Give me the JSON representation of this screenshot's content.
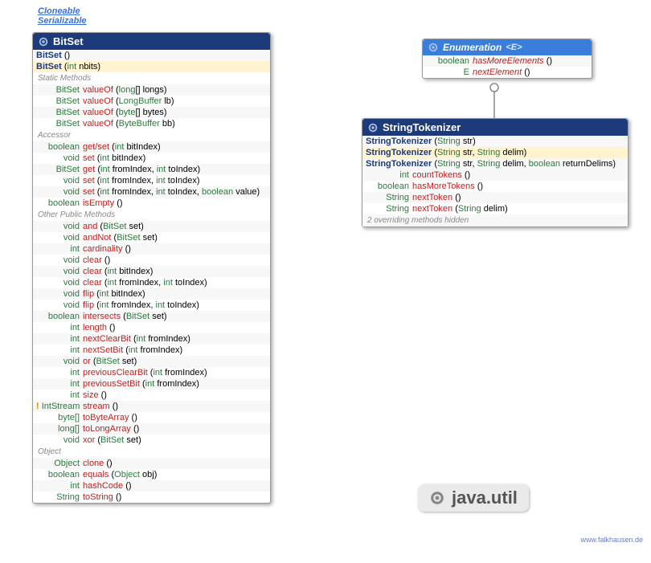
{
  "implements": {
    "cloneable": "Cloneable",
    "serializable": "Serializable"
  },
  "bitset": {
    "title": "BitSet",
    "ctors": [
      {
        "name": "BitSet",
        "params": "()"
      },
      {
        "name": "BitSet",
        "params": "(int nbits)"
      }
    ],
    "sect_static": "Static Methods",
    "static": [
      {
        "ret": "BitSet",
        "name": "valueOf",
        "p": "(long[] longs)"
      },
      {
        "ret": "BitSet",
        "name": "valueOf",
        "p": "(LongBuffer lb)"
      },
      {
        "ret": "BitSet",
        "name": "valueOf",
        "p": "(byte[] bytes)"
      },
      {
        "ret": "BitSet",
        "name": "valueOf",
        "p": "(ByteBuffer bb)"
      }
    ],
    "sect_acc": "Accessor",
    "acc": [
      {
        "ret": "boolean",
        "name": "get/set",
        "p": "(int bitIndex)"
      },
      {
        "ret": "void",
        "name": "set",
        "p": "(int bitIndex)"
      },
      {
        "ret": "BitSet",
        "name": "get",
        "p": "(int fromIndex, int toIndex)"
      },
      {
        "ret": "void",
        "name": "set",
        "p": "(int fromIndex, int toIndex)"
      },
      {
        "ret": "void",
        "name": "set",
        "p": "(int fromIndex, int toIndex, boolean value)"
      },
      {
        "ret": "boolean",
        "name": "isEmpty",
        "p": "()"
      }
    ],
    "sect_other": "Other Public Methods",
    "other": [
      {
        "ret": "void",
        "name": "and",
        "p": "(BitSet set)"
      },
      {
        "ret": "void",
        "name": "andNot",
        "p": "(BitSet set)"
      },
      {
        "ret": "int",
        "name": "cardinality",
        "p": "()"
      },
      {
        "ret": "void",
        "name": "clear",
        "p": "()"
      },
      {
        "ret": "void",
        "name": "clear",
        "p": "(int bitIndex)"
      },
      {
        "ret": "void",
        "name": "clear",
        "p": "(int fromIndex, int toIndex)"
      },
      {
        "ret": "void",
        "name": "flip",
        "p": "(int bitIndex)"
      },
      {
        "ret": "void",
        "name": "flip",
        "p": "(int fromIndex, int toIndex)"
      },
      {
        "ret": "boolean",
        "name": "intersects",
        "p": "(BitSet set)"
      },
      {
        "ret": "int",
        "name": "length",
        "p": "()"
      },
      {
        "ret": "int",
        "name": "nextClearBit",
        "p": "(int fromIndex)"
      },
      {
        "ret": "int",
        "name": "nextSetBit",
        "p": "(int fromIndex)"
      },
      {
        "ret": "void",
        "name": "or",
        "p": "(BitSet set)"
      },
      {
        "ret": "int",
        "name": "previousClearBit",
        "p": "(int fromIndex)"
      },
      {
        "ret": "int",
        "name": "previousSetBit",
        "p": "(int fromIndex)"
      },
      {
        "ret": "int",
        "name": "size",
        "p": "()"
      },
      {
        "ret": "! IntStream",
        "name": "stream",
        "p": "()",
        "excl": true
      },
      {
        "ret": "byte[]",
        "name": "toByteArray",
        "p": "()"
      },
      {
        "ret": "long[]",
        "name": "toLongArray",
        "p": "()"
      },
      {
        "ret": "void",
        "name": "xor",
        "p": "(BitSet set)"
      }
    ],
    "sect_obj": "Object",
    "obj": [
      {
        "ret": "Object",
        "name": "clone",
        "p": "()"
      },
      {
        "ret": "boolean",
        "name": "equals",
        "p": "(Object obj)"
      },
      {
        "ret": "int",
        "name": "hashCode",
        "p": "()"
      },
      {
        "ret": "String",
        "name": "toString",
        "p": "()"
      }
    ]
  },
  "enumeration": {
    "title": "Enumeration",
    "generic": "<E>",
    "methods": [
      {
        "ret": "boolean",
        "name": "hasMoreElements",
        "p": "()"
      },
      {
        "ret": "E",
        "name": "nextElement",
        "p": "()"
      }
    ]
  },
  "stringtokenizer": {
    "title": "StringTokenizer",
    "ctors": [
      {
        "name": "StringTokenizer",
        "p": "(String str)"
      },
      {
        "name": "StringTokenizer",
        "p": "(String str, String delim)"
      },
      {
        "name": "StringTokenizer",
        "p": "(String str, String delim, boolean returnDelims)"
      }
    ],
    "methods": [
      {
        "ret": "int",
        "name": "countTokens",
        "p": "()"
      },
      {
        "ret": "boolean",
        "name": "hasMoreTokens",
        "p": "()"
      },
      {
        "ret": "String",
        "name": "nextToken",
        "p": "()"
      },
      {
        "ret": "String",
        "name": "nextToken",
        "p": "(String delim)"
      }
    ],
    "hidden": "2 overriding methods hidden"
  },
  "package": "java.util",
  "credit": "www.falkhausen.de"
}
